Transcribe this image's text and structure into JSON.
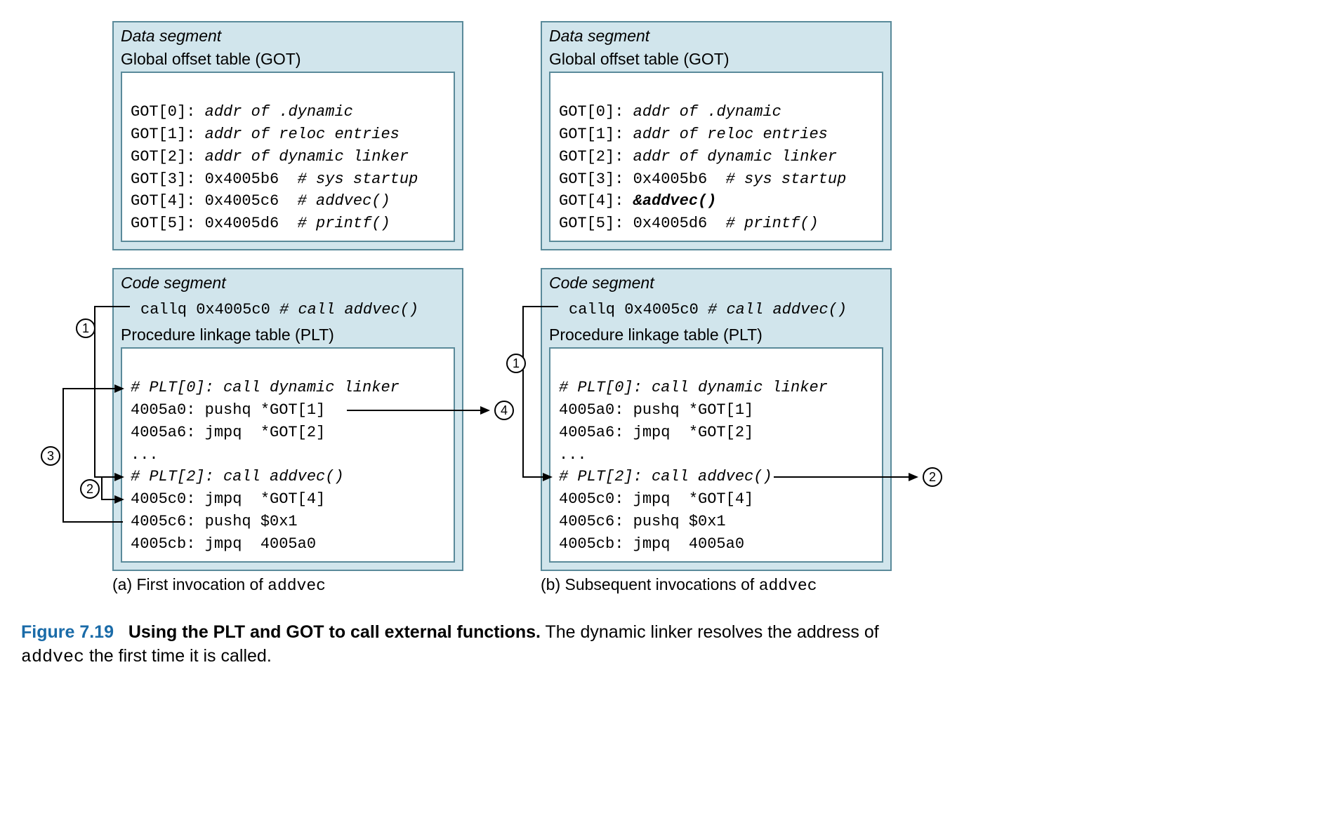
{
  "left": {
    "data_segment_title": "Data segment",
    "got_title": "Global offset table (GOT)",
    "got": [
      {
        "label": "GOT[0]:",
        "val": "addr of .dynamic",
        "italic": true
      },
      {
        "label": "GOT[1]:",
        "val": "addr of reloc entries",
        "italic": true
      },
      {
        "label": "GOT[2]:",
        "val": "addr of dynamic linker",
        "italic": true
      },
      {
        "label": "GOT[3]:",
        "val": "0x4005b6",
        "comment": "# sys startup"
      },
      {
        "label": "GOT[4]:",
        "val": "0x4005c6",
        "comment": "# addvec()"
      },
      {
        "label": "GOT[5]:",
        "val": "0x4005d6",
        "comment": "# printf()"
      }
    ],
    "code_segment_title": "Code segment",
    "call_line": {
      "instr": "callq 0x4005c0",
      "comment": "# call addvec()"
    },
    "plt_title": "Procedure linkage table (PLT)",
    "plt": [
      {
        "text": "# PLT[0]: call dynamic linker",
        "italic": true
      },
      {
        "text": "4005a0: pushq *GOT[1]"
      },
      {
        "text": "4005a6: jmpq  *GOT[2]"
      },
      {
        "text": "..."
      },
      {
        "text": "# PLT[2]: call addvec()",
        "italic": true
      },
      {
        "text": "4005c0: jmpq  *GOT[4]"
      },
      {
        "text": "4005c6: pushq $0x1"
      },
      {
        "text": "4005cb: jmpq  4005a0"
      }
    ],
    "sub_caption_a": "(a) First invocation of ",
    "sub_caption_b": "addvec"
  },
  "right": {
    "data_segment_title": "Data segment",
    "got_title": "Global offset table (GOT)",
    "got": [
      {
        "label": "GOT[0]:",
        "val": "addr of .dynamic",
        "italic": true
      },
      {
        "label": "GOT[1]:",
        "val": "addr of reloc entries",
        "italic": true
      },
      {
        "label": "GOT[2]:",
        "val": "addr of dynamic linker",
        "italic": true
      },
      {
        "label": "GOT[3]:",
        "val": "0x4005b6",
        "comment": "# sys startup"
      },
      {
        "label": "GOT[4]:",
        "val": "&addvec()",
        "bold": true
      },
      {
        "label": "GOT[5]:",
        "val": "0x4005d6",
        "comment": "# printf()"
      }
    ],
    "code_segment_title": "Code segment",
    "call_line": {
      "instr": "callq 0x4005c0",
      "comment": "# call addvec()"
    },
    "plt_title": "Procedure linkage table (PLT)",
    "plt": [
      {
        "text": "# PLT[0]: call dynamic linker",
        "italic": true
      },
      {
        "text": "4005a0: pushq *GOT[1]"
      },
      {
        "text": "4005a6: jmpq  *GOT[2]"
      },
      {
        "text": "..."
      },
      {
        "text": "# PLT[2]: call addvec()",
        "italic": true
      },
      {
        "text": "4005c0: jmpq  *GOT[4]"
      },
      {
        "text": "4005c6: pushq $0x1"
      },
      {
        "text": "4005cb: jmpq  4005a0"
      }
    ],
    "sub_caption_a": "(b) Subsequent invocations of ",
    "sub_caption_b": "addvec"
  },
  "caption": {
    "label": "Figure 7.19",
    "title": "Using the PLT and GOT to call external functions.",
    "rest1": "The dynamic linker resolves the address of ",
    "mono": "addvec",
    "rest2": " the first time it is called."
  },
  "nums": {
    "1": "1",
    "2": "2",
    "3": "3",
    "4": "4"
  }
}
